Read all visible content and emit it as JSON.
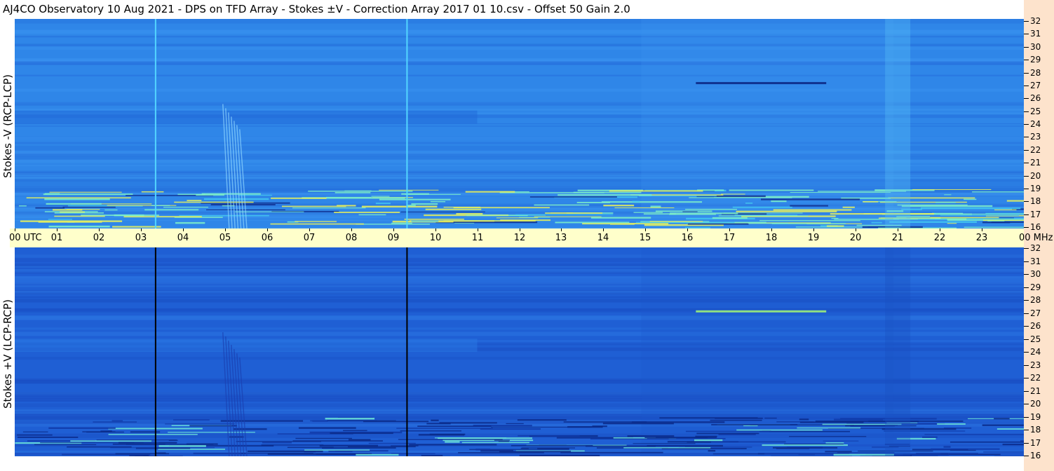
{
  "title": "AJ4CO Observatory  10 Aug 2021  -  DPS on TFD Array  -  Stokes ±V  -  Correction Array 2017 01 10.csv  -  Offset 50  Gain 2.0",
  "chart_data": {
    "type": "heatmap",
    "x_axis": {
      "unit": "UTC",
      "ticks": [
        "00",
        "01",
        "02",
        "03",
        "04",
        "05",
        "06",
        "07",
        "08",
        "09",
        "10",
        "11",
        "12",
        "13",
        "14",
        "15",
        "16",
        "17",
        "18",
        "19",
        "20",
        "21",
        "22",
        "23"
      ],
      "end_label": "00",
      "range_hours": [
        0,
        24
      ]
    },
    "y_axis": {
      "unit": "MHz",
      "ticks": [
        32,
        31,
        30,
        29,
        28,
        27,
        26,
        25,
        24,
        23,
        22,
        21,
        20,
        19,
        18,
        17,
        16
      ],
      "range": [
        16,
        32
      ]
    },
    "panels": [
      {
        "label": "Stokes -V (RCP-LCP)",
        "colormap": "blue-cyan-yellow",
        "background": "#2f86e8"
      },
      {
        "label": "Stokes +V (LCP-RCP)",
        "colormap": "blue-cyan-yellow",
        "background": "#1f5fd4"
      }
    ],
    "features": [
      {
        "name": "vertical line",
        "utc_hour": 3.35
      },
      {
        "name": "vertical line",
        "utc_hour": 9.33
      },
      {
        "name": "drifting emission",
        "utc_start": 4.95,
        "utc_end": 5.55,
        "mhz_top": 25.5,
        "mhz_bottom": 16
      },
      {
        "name": "horizontal band",
        "utc_start": 16.2,
        "utc_end": 19.3,
        "mhz": 27.1
      },
      {
        "name": "low-frequency interference band",
        "mhz_range": [
          16,
          19
        ]
      }
    ],
    "grid": false
  }
}
